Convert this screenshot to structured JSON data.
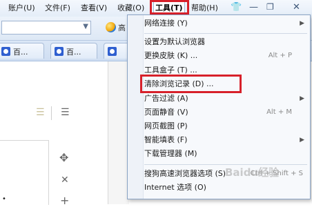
{
  "menubar": {
    "items": [
      "账户(U)",
      "文件(F)",
      "查看(V)",
      "收藏(O)",
      "工具(T)",
      "帮助(H)"
    ],
    "active_index": 4
  },
  "tabs": [
    "百...",
    "百..."
  ],
  "search_letter": "高",
  "tools_menu": {
    "items": [
      {
        "label": "网络连接 (Y)",
        "submenu": true,
        "shortcut": ""
      },
      {
        "label": "设置为默认浏览器",
        "submenu": false,
        "shortcut": ""
      },
      {
        "label": "更换皮肤 (K) ...",
        "submenu": false,
        "shortcut": "Alt + P"
      },
      {
        "label": "工具盒子 (T) ...",
        "submenu": false,
        "shortcut": ""
      },
      {
        "label": "清除浏览记录 (D) ...",
        "submenu": false,
        "shortcut": ""
      },
      {
        "label": "广告过滤 (A)",
        "submenu": true,
        "shortcut": ""
      },
      {
        "label": "页面静音 (V)",
        "submenu": false,
        "shortcut": "Alt + M"
      },
      {
        "label": "网页截图 (P)",
        "submenu": false,
        "shortcut": ""
      },
      {
        "label": "智能填表 (F)",
        "submenu": true,
        "shortcut": ""
      },
      {
        "label": "下载管理器 (M)",
        "submenu": false,
        "shortcut": ""
      },
      {
        "label": "搜狗高速浏览器选项 (S)",
        "submenu": false,
        "shortcut": "Ctrl + Shift + S"
      },
      {
        "label": "Internet 选项 (O)",
        "submenu": false,
        "shortcut": ""
      }
    ]
  },
  "watermark": "Baidu经验",
  "icons": [
    "chevron-down-icon",
    "search-globe-icon",
    "paw-icon",
    "list-icon",
    "move-icon",
    "close-icon",
    "plus-icon",
    "tshirt-icon",
    "minimize-icon",
    "restore-icon",
    "window-close-icon",
    "submenu-arrow-icon"
  ],
  "colors": {
    "highlight": "#d7202a",
    "menu_border": "#8aa3c4"
  }
}
